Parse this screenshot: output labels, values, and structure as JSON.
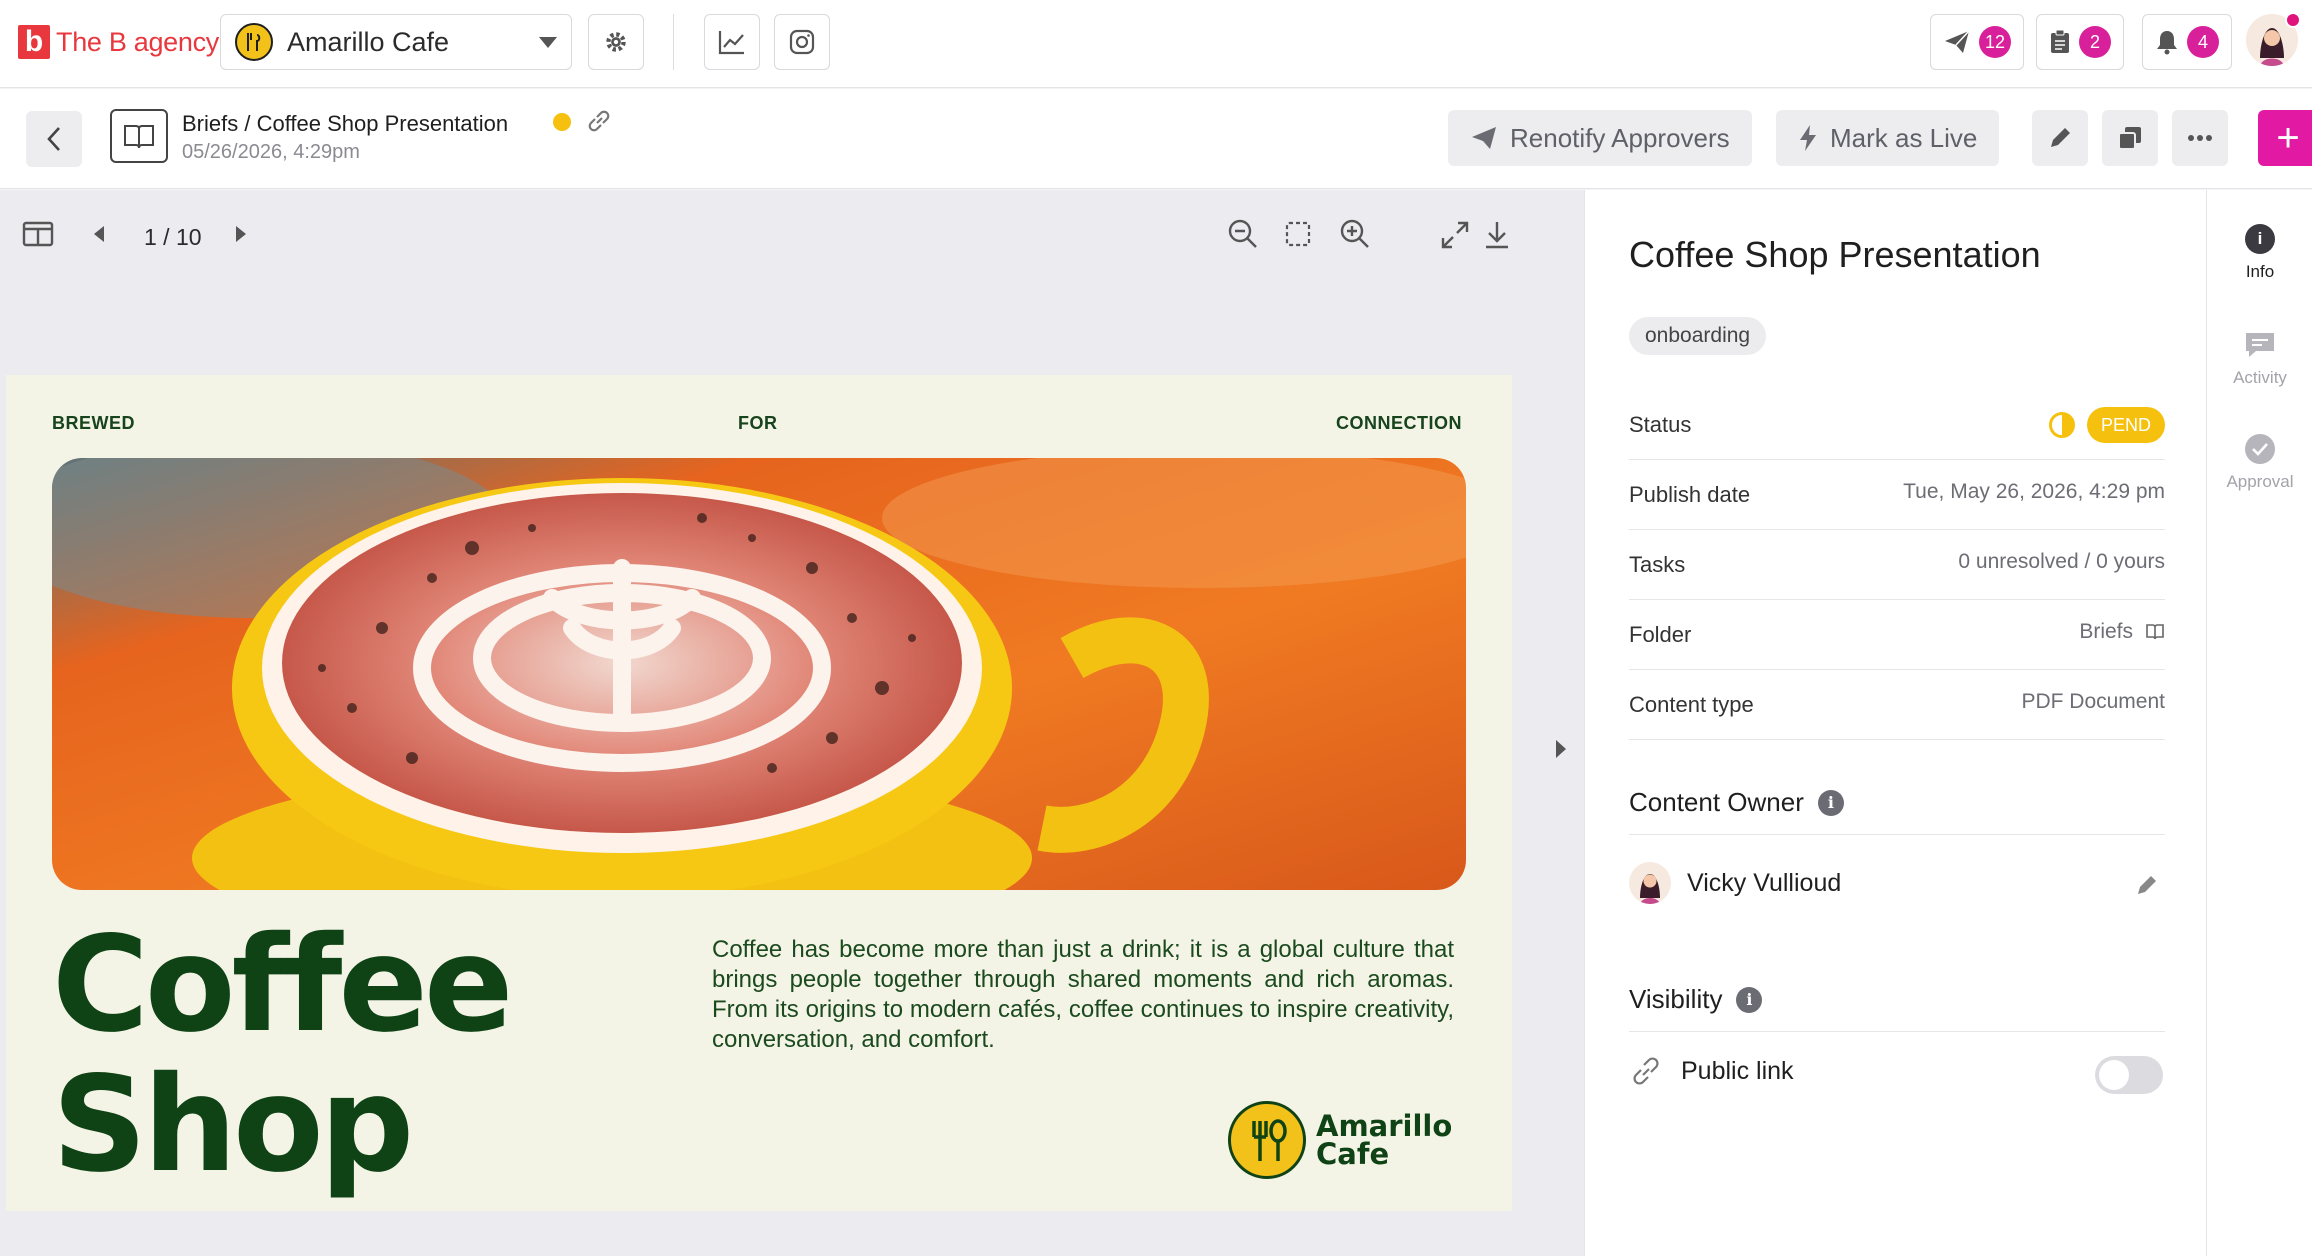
{
  "brand": {
    "mark": "b",
    "name": "The B agency"
  },
  "account": {
    "name": "Amarillo Cafe"
  },
  "header": {
    "notifications": [
      {
        "name": "send",
        "icon": "paper-plane-icon",
        "count": "12"
      },
      {
        "name": "tasks",
        "icon": "clipboard-icon",
        "count": "2"
      },
      {
        "name": "alerts",
        "icon": "bell-icon",
        "count": "4"
      }
    ]
  },
  "subbar": {
    "breadcrumb": "Briefs / Coffee Shop Presentation",
    "date": "05/26/2026, 4:29pm",
    "renotify_label": "Renotify Approvers",
    "mark_live_label": "Mark as Live",
    "plus_label": "+"
  },
  "viewer": {
    "page_indicator": "1 / 10"
  },
  "slide": {
    "top_words": [
      "BREWED",
      "FOR",
      "CONNECTION"
    ],
    "title_line1": "Coffee",
    "title_line2": "Shop",
    "copy": "Coffee has become more than just a drink; it is a global culture that brings people together through shared moments and rich aromas. From its origins to modern cafés, coffee continues to inspire creativity, conversation, and comfort.",
    "brand_line1": "Amarillo",
    "brand_line2": "Cafe"
  },
  "panel": {
    "title": "Coffee Shop Presentation",
    "tag": "onboarding",
    "rows": [
      {
        "label": "Status",
        "value": "PEND"
      },
      {
        "label": "Publish date",
        "value": "Tue, May 26, 2026, 4:29 pm"
      },
      {
        "label": "Tasks",
        "value": "0 unresolved / 0 yours"
      },
      {
        "label": "Folder",
        "value": "Briefs"
      },
      {
        "label": "Content type",
        "value": "PDF Document"
      }
    ],
    "owner_section": "Content Owner",
    "owner_name": "Vicky Vullioud",
    "visibility_section": "Visibility",
    "public_link_label": "Public link",
    "public_link_enabled": false
  },
  "sidetabs": [
    {
      "label": "Info",
      "active": true
    },
    {
      "label": "Activity",
      "active": false
    },
    {
      "label": "Approval",
      "active": false
    }
  ],
  "colors": {
    "brand_red": "#e8383d",
    "accent_pink": "#e21aa3",
    "pending_yellow": "#f5c10e",
    "slide_green": "#0f4315"
  }
}
